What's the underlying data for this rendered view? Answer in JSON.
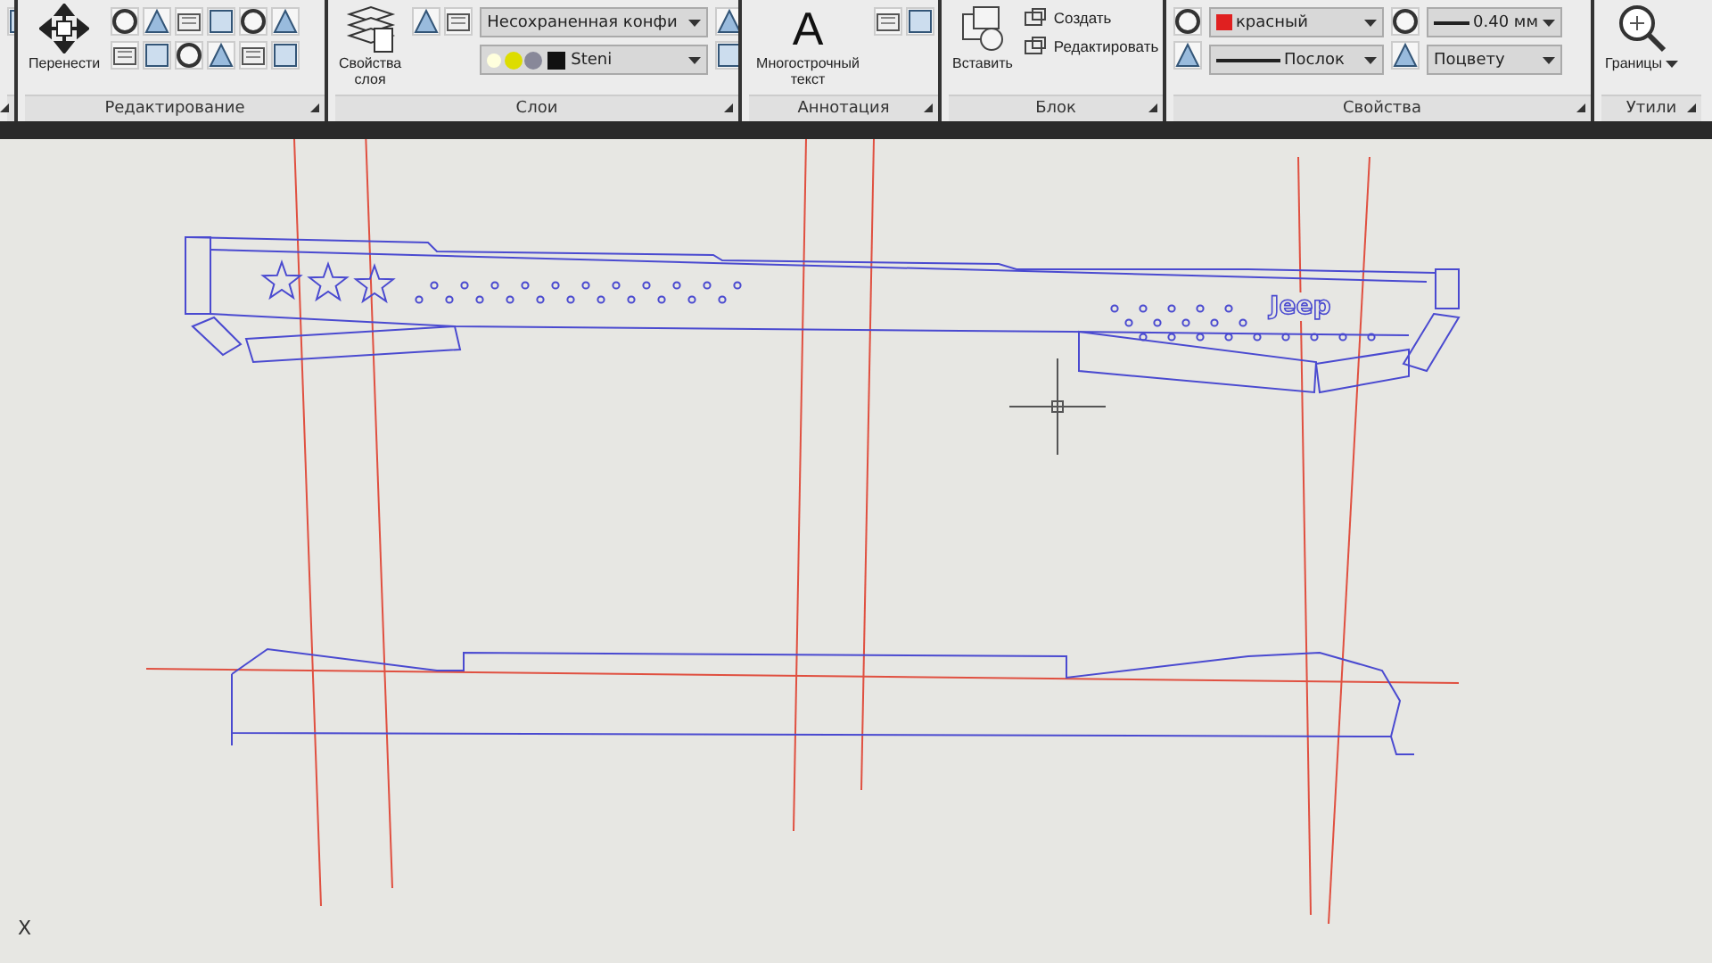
{
  "ribbon": {
    "panels": [
      {
        "tools": [
          {
            "kind": "icons"
          }
        ]
      },
      {
        "title": "Редактирование",
        "tools": [
          {
            "kind": "large",
            "label": "Перенести"
          },
          {
            "kind": "icons"
          }
        ]
      },
      {
        "title": "Слои",
        "tools": [
          {
            "kind": "large",
            "label": "Свойства слоя"
          },
          {
            "kind": "icons"
          },
          {
            "kind": "dropdowns",
            "items": [
              {
                "value": "Несохраненная конфи"
              },
              {
                "value": "Steni"
              }
            ]
          },
          {
            "kind": "icons"
          }
        ]
      },
      {
        "title": "Аннотация",
        "tools": [
          {
            "kind": "glyph",
            "glyph": "A",
            "label": "Многострочный текст"
          },
          {
            "kind": "icons"
          }
        ]
      },
      {
        "title": "Блок",
        "tools": [
          {
            "kind": "large",
            "label": "Вставить"
          },
          {
            "kind": "links",
            "items": [
              "Создать",
              "Редактировать"
            ]
          }
        ]
      },
      {
        "title": "Свойства",
        "tools": [
          {
            "kind": "icons"
          },
          {
            "kind": "dropdowns",
            "items": [
              {
                "value": "красный",
                "color": "#e02020"
              },
              {
                "value": "Послок"
              }
            ]
          },
          {
            "kind": "icons"
          },
          {
            "kind": "dropdowns",
            "items": [
              {
                "value": "0.40 мм"
              },
              {
                "value": "Поцвету"
              }
            ]
          }
        ]
      },
      {
        "title": "Утили",
        "tools": [
          {
            "kind": "large",
            "label": "Границы"
          }
        ]
      }
    ]
  },
  "drawing": {
    "logo_text": "Jeep",
    "axis_label": "X"
  }
}
